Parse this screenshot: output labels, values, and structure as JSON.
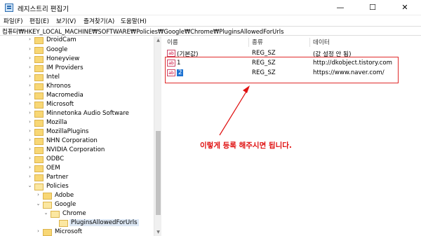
{
  "window": {
    "title": "레지스트리 편집기",
    "min_glyph": "—",
    "max_glyph": "☐",
    "close_glyph": "✕"
  },
  "menu": [
    "파일(F)",
    "편집(E)",
    "보기(V)",
    "즐겨찾기(A)",
    "도움말(H)"
  ],
  "address": "컴퓨터₩HKEY_LOCAL_MACHINE₩SOFTWARE₩Policies₩Google₩Chrome₩PluginsAllowedForUrls",
  "tree": [
    {
      "label": "DroidCam",
      "expander": "›"
    },
    {
      "label": "Google",
      "expander": "›"
    },
    {
      "label": "Honeyview",
      "expander": "›"
    },
    {
      "label": "IM Providers",
      "expander": "›"
    },
    {
      "label": "Intel",
      "expander": "›"
    },
    {
      "label": "Khronos",
      "expander": "›"
    },
    {
      "label": "Macromedia",
      "expander": "›"
    },
    {
      "label": "Microsoft",
      "expander": "›"
    },
    {
      "label": "Minnetonka Audio Software",
      "expander": "›"
    },
    {
      "label": "Mozilla",
      "expander": "›"
    },
    {
      "label": "MozillaPlugins",
      "expander": "›"
    },
    {
      "label": "NHN Corporation",
      "expander": "›"
    },
    {
      "label": "NVIDIA Corporation",
      "expander": "›"
    },
    {
      "label": "ODBC",
      "expander": "›"
    },
    {
      "label": "OEM",
      "expander": "›"
    },
    {
      "label": "Partner",
      "expander": "›"
    },
    {
      "label": "Policies",
      "expander": "⌄"
    },
    {
      "label": "Adobe",
      "expander": "›"
    },
    {
      "label": "Google",
      "expander": "⌄"
    },
    {
      "label": "Chrome",
      "expander": "⌄"
    },
    {
      "label": "PluginsAllowedForUrls",
      "expander": ""
    },
    {
      "label": "Microsoft",
      "expander": "›"
    }
  ],
  "columns": {
    "name": "이름",
    "type": "종류",
    "data": "데이터"
  },
  "values": [
    {
      "icon": "ab",
      "name": "(기본값)",
      "type": "REG_SZ",
      "data": "(값 설정 안 됨)"
    },
    {
      "icon": "ab",
      "name": "1",
      "type": "REG_SZ",
      "data": "http://dkobject.tistory.com"
    },
    {
      "icon": "ab",
      "name": "2",
      "type": "REG_SZ",
      "data": "https://www.naver.com/"
    }
  ],
  "annotation": "이렇게 등록 해주시면 됩니다.",
  "colors": {
    "annotation": "#e01010",
    "selection": "#1e73d2",
    "folder": "#f8d775"
  }
}
